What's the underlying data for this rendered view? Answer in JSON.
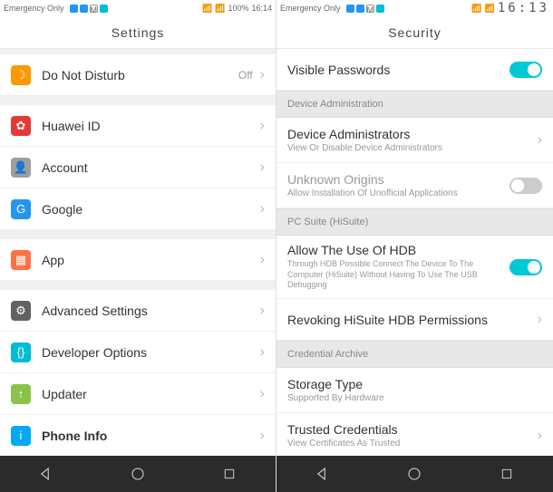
{
  "left": {
    "statusbar": {
      "carrier": "Emergency Only",
      "battery": "100%",
      "time": "16:14"
    },
    "title": "Settings",
    "items": {
      "dnd": {
        "label": "Do Not Disturb",
        "value": "Off"
      },
      "huawei": {
        "label": "Huawei ID"
      },
      "account": {
        "label": "Account"
      },
      "google": {
        "label": "Google"
      },
      "app": {
        "label": "App"
      },
      "advanced": {
        "label": "Advanced Settings"
      },
      "developer": {
        "label": "Developer Options"
      },
      "updater": {
        "label": "Updater"
      },
      "phone": {
        "label": "Phone Info"
      }
    }
  },
  "right": {
    "statusbar": {
      "carrier": "Emergency Only",
      "time": "16:13"
    },
    "title": "Security",
    "sections": {
      "device_admin": "Device Administration",
      "pc_suite": "PC Suite (HiSuite)",
      "credential": "Credential Archive"
    },
    "items": {
      "visible_passwords": {
        "label": "Visible Passwords",
        "toggle": true
      },
      "device_admins": {
        "label": "Device Administrators",
        "sub": "View Or Disable Device Administrators"
      },
      "unknown_origins": {
        "label": "Unknown Origins",
        "sub": "Allow Installation Of Unofficial Applications",
        "toggle": false
      },
      "allow_hdb": {
        "label": "Allow The Use Of HDB",
        "sub": "Through HDB Possible Connect The Device To The Computer (HiSuite) Without Having To Use The USB Debugging",
        "toggle": true
      },
      "revoke_hdb": {
        "label": "Revoking HiSuite HDB Permissions"
      },
      "storage_type": {
        "label": "Storage Type",
        "sub": "Supported By Hardware"
      },
      "trusted_creds": {
        "label": "Trusted Credentials",
        "sub": "View Certificates As Trusted"
      }
    }
  }
}
